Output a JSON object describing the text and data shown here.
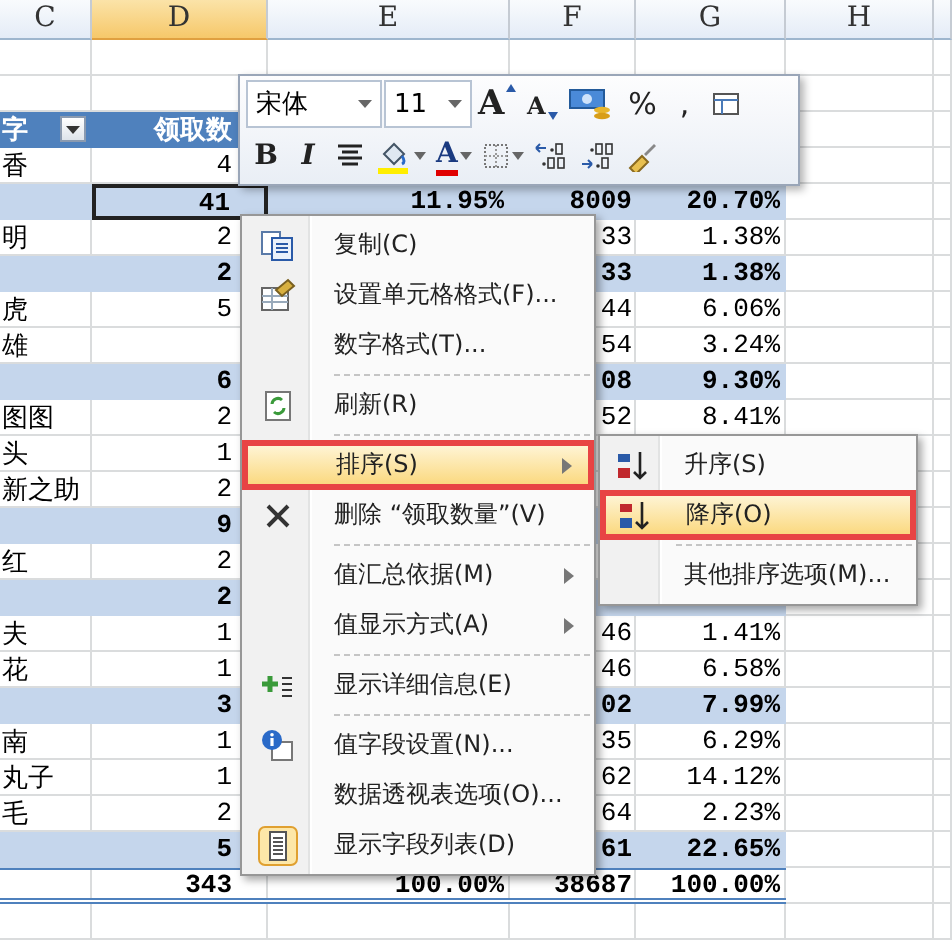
{
  "columns": [
    {
      "label": "C",
      "selected": false
    },
    {
      "label": "D",
      "selected": true
    },
    {
      "label": "E",
      "selected": false
    },
    {
      "label": "F",
      "selected": false
    },
    {
      "label": "G",
      "selected": false
    },
    {
      "label": "H",
      "selected": false
    }
  ],
  "rows": [
    {
      "kind": "blank",
      "active": false
    },
    {
      "kind": "blank",
      "active": false
    },
    {
      "kind": "header",
      "active": false,
      "c": "字",
      "d": "领取数",
      "filter": true
    },
    {
      "kind": "item",
      "active": false,
      "c": "香",
      "d": "4"
    },
    {
      "kind": "subtotal",
      "active": true,
      "d": "41",
      "e": "11.95%",
      "f": "8009",
      "g": "20.70%"
    },
    {
      "kind": "item",
      "active": false,
      "c": "明",
      "d": "2",
      "f": "33",
      "g": "1.38%"
    },
    {
      "kind": "subtotal",
      "active": false,
      "d": "2",
      "f": "33",
      "g": "1.38%"
    },
    {
      "kind": "item",
      "active": false,
      "c": "虎",
      "d": "5",
      "f": "44",
      "g": "6.06%"
    },
    {
      "kind": "item",
      "active": false,
      "c": "雄",
      "f": "54",
      "g": "3.24%"
    },
    {
      "kind": "subtotal",
      "active": false,
      "d": "6",
      "f": "08",
      "g": "9.30%"
    },
    {
      "kind": "item",
      "active": false,
      "c": "图图",
      "d": "2",
      "f": "52",
      "g": "8.41%"
    },
    {
      "kind": "item",
      "active": false,
      "c": "头",
      "d": "1"
    },
    {
      "kind": "item",
      "active": false,
      "c": "新之助",
      "d": "2"
    },
    {
      "kind": "subtotal",
      "active": false,
      "d": "9"
    },
    {
      "kind": "item",
      "active": false,
      "c": "红",
      "d": "2"
    },
    {
      "kind": "subtotal",
      "active": false,
      "d": "2"
    },
    {
      "kind": "item",
      "active": false,
      "c": "夫",
      "d": "1",
      "f": "46",
      "g": "1.41%"
    },
    {
      "kind": "item",
      "active": false,
      "c": "花",
      "d": "1",
      "f": "46",
      "g": "6.58%"
    },
    {
      "kind": "subtotal",
      "active": false,
      "d": "3",
      "f": "02",
      "g": "7.99%"
    },
    {
      "kind": "item",
      "active": false,
      "c": "南",
      "d": "1",
      "f": "35",
      "g": "6.29%"
    },
    {
      "kind": "item",
      "active": false,
      "c": "丸子",
      "d": "1",
      "f": "62",
      "g": "14.12%"
    },
    {
      "kind": "item",
      "active": false,
      "c": "毛",
      "d": "2",
      "f": "64",
      "g": "2.23%"
    },
    {
      "kind": "subtotal",
      "active": false,
      "d": "5",
      "f": "61",
      "g": "22.65%"
    },
    {
      "kind": "total",
      "active": false,
      "d": "343",
      "e": "100.00%",
      "f": "38687",
      "g": "100.00%"
    },
    {
      "kind": "blank",
      "active": false
    }
  ],
  "toolbar": {
    "font": "宋体",
    "size": "11",
    "row_1": [
      {
        "kind": "grow",
        "label": "A"
      },
      {
        "kind": "shrink",
        "label": "A"
      },
      {
        "kind": "money"
      },
      {
        "kind": "percent",
        "label": "%"
      },
      {
        "kind": "comma",
        "label": ","
      },
      {
        "kind": "format"
      }
    ],
    "row_2": [
      {
        "kind": "bold",
        "label": "B"
      },
      {
        "kind": "italic",
        "label": "I"
      },
      {
        "kind": "center"
      },
      {
        "kind": "fill"
      },
      {
        "kind": "font-color",
        "label": "A"
      },
      {
        "kind": "borders"
      },
      {
        "kind": "inc-decimal"
      },
      {
        "kind": "dec-decimal"
      },
      {
        "kind": "painter"
      }
    ]
  },
  "menu": {
    "items": [
      {
        "kind": "item",
        "label": "复制(C)",
        "selected": false,
        "submenu": false
      },
      {
        "kind": "item",
        "label": "设置单元格格式(F)...",
        "selected": false,
        "submenu": false
      },
      {
        "kind": "item",
        "label": "数字格式(T)...",
        "selected": false,
        "submenu": false
      },
      {
        "kind": "separator"
      },
      {
        "kind": "item",
        "label": "刷新(R)",
        "selected": false,
        "submenu": false
      },
      {
        "kind": "separator"
      },
      {
        "kind": "item",
        "label": "排序(S)",
        "selected": true,
        "submenu": true
      },
      {
        "kind": "item",
        "label": "删除 “领取数量”(V)",
        "selected": false,
        "submenu": false
      },
      {
        "kind": "separator"
      },
      {
        "kind": "item",
        "label": "值汇总依据(M)",
        "selected": false,
        "submenu": true
      },
      {
        "kind": "item",
        "label": "值显示方式(A)",
        "selected": false,
        "submenu": true
      },
      {
        "kind": "separator"
      },
      {
        "kind": "item",
        "label": "显示详细信息(E)",
        "selected": false,
        "submenu": false
      },
      {
        "kind": "separator"
      },
      {
        "kind": "item",
        "label": "值字段设置(N)...",
        "selected": false,
        "submenu": false
      },
      {
        "kind": "item",
        "label": "数据透视表选项(O)...",
        "selected": false,
        "submenu": false
      },
      {
        "kind": "item",
        "label": "显示字段列表(D)",
        "selected": false,
        "submenu": false
      }
    ]
  },
  "submenu": {
    "items": [
      {
        "kind": "item",
        "label": "升序(S)",
        "selected": false
      },
      {
        "kind": "item",
        "label": "降序(O)",
        "selected": true
      },
      {
        "kind": "separator"
      },
      {
        "kind": "item",
        "label": "其他排序选项(M)...",
        "selected": false
      }
    ]
  }
}
